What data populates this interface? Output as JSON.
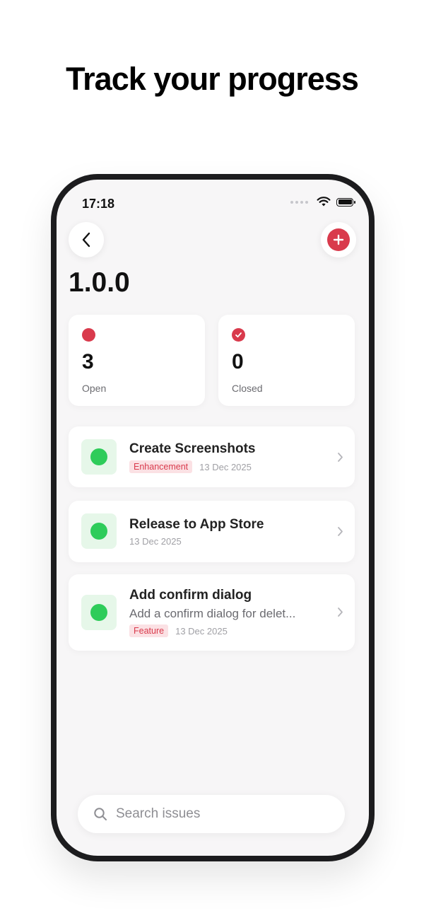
{
  "headline": "Track your progress",
  "status_bar": {
    "time": "17:18"
  },
  "header": {
    "version": "1.0.0"
  },
  "colors": {
    "accent": "#d93a4c",
    "open_green": "#2ecc5a",
    "tag_bg": "#fbe1e4"
  },
  "stats": [
    {
      "count": "3",
      "label": "Open",
      "icon": "open-dot-icon"
    },
    {
      "count": "0",
      "label": "Closed",
      "icon": "closed-check-icon"
    }
  ],
  "issues": [
    {
      "title": "Create Screenshots",
      "tag": "Enhancement",
      "date": "13 Dec 2025"
    },
    {
      "title": "Release to App Store",
      "date": "13 Dec 2025"
    },
    {
      "title": "Add confirm dialog",
      "description": "Add a confirm dialog for delet...",
      "tag": "Feature",
      "date": "13 Dec 2025"
    }
  ],
  "search": {
    "placeholder": "Search issues"
  }
}
